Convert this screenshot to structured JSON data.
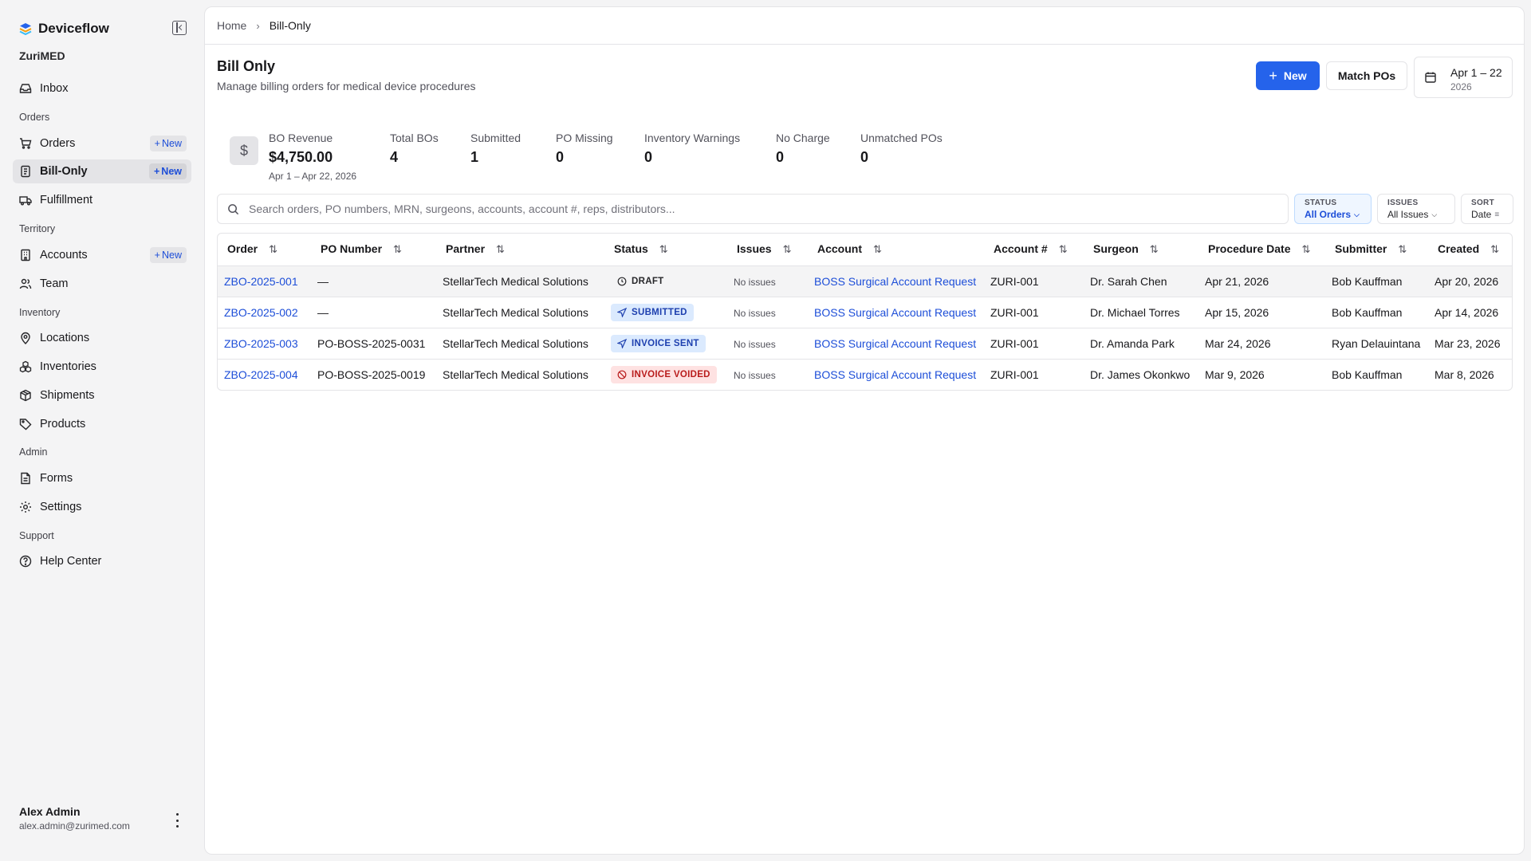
{
  "sidebar": {
    "brand": "Deviceflow",
    "org": "ZuriMED",
    "items": {
      "inbox": "Inbox",
      "orders_section": "Orders",
      "orders": "Orders",
      "bill_only": "Bill-Only",
      "fulfillment": "Fulfillment",
      "territory_section": "Territory",
      "accounts": "Accounts",
      "team": "Team",
      "inventory_section": "Inventory",
      "locations": "Locations",
      "inventories": "Inventories",
      "shipments": "Shipments",
      "products": "Products",
      "admin_section": "Admin",
      "forms": "Forms",
      "settings": "Settings",
      "support_section": "Support",
      "help_center": "Help Center"
    },
    "new_label": "New",
    "user": {
      "name": "Alex Admin",
      "email": "alex.admin@zurimed.com"
    }
  },
  "breadcrumb": {
    "home": "Home",
    "current": "Bill-Only"
  },
  "header": {
    "title": "Bill Only",
    "subtitle": "Manage billing orders for medical device procedures",
    "new_button": "New",
    "match_button": "Match POs",
    "date_range": "Apr 1 – 22",
    "date_year": "2026"
  },
  "stats": {
    "revenue_label": "BO Revenue",
    "revenue_value": "$4,750.00",
    "revenue_sub": "Apr 1 – Apr 22, 2026",
    "revenue_icon": "$",
    "total_label": "Total BOs",
    "total_value": "4",
    "submitted_label": "Submitted",
    "submitted_value": "1",
    "po_missing_label": "PO Missing",
    "po_missing_value": "0",
    "inv_warn_label": "Inventory Warnings",
    "inv_warn_value": "0",
    "no_charge_label": "No Charge",
    "no_charge_value": "0",
    "unmatched_label": "Unmatched POs",
    "unmatched_value": "0"
  },
  "search": {
    "placeholder": "Search orders, PO numbers, MRN, surgeons, accounts, account #, reps, distributors..."
  },
  "filters": {
    "status_label": "STATUS",
    "status_value": "All Orders",
    "issues_label": "ISSUES",
    "issues_value": "All Issues",
    "sort_label": "SORT",
    "sort_value": "Date"
  },
  "table": {
    "columns": [
      "Order",
      "PO Number",
      "Partner",
      "Status",
      "Issues",
      "Account",
      "Account #",
      "Surgeon",
      "Procedure Date",
      "Submitter",
      "Created"
    ],
    "rows": [
      {
        "order": "ZBO-2025-001",
        "po": "—",
        "partner": "StellarTech Medical Solutions",
        "status": "DRAFT",
        "issues": "No issues",
        "account": "BOSS Surgical Account Request",
        "account_no": "ZURI-001",
        "surgeon": "Dr. Sarah Chen",
        "procedure_date": "Apr 21, 2026",
        "submitter": "Bob Kauffman",
        "created": "Apr 20, 2026"
      },
      {
        "order": "ZBO-2025-002",
        "po": "—",
        "partner": "StellarTech Medical Solutions",
        "status": "SUBMITTED",
        "issues": "No issues",
        "account": "BOSS Surgical Account Request",
        "account_no": "ZURI-001",
        "surgeon": "Dr. Michael Torres",
        "procedure_date": "Apr 15, 2026",
        "submitter": "Bob Kauffman",
        "created": "Apr 14, 2026"
      },
      {
        "order": "ZBO-2025-003",
        "po": "PO-BOSS-2025-0031",
        "partner": "StellarTech Medical Solutions",
        "status": "INVOICE SENT",
        "issues": "No issues",
        "account": "BOSS Surgical Account Request",
        "account_no": "ZURI-001",
        "surgeon": "Dr. Amanda Park",
        "procedure_date": "Mar 24, 2026",
        "submitter": "Ryan Delauintana",
        "created": "Mar 23, 2026"
      },
      {
        "order": "ZBO-2025-004",
        "po": "PO-BOSS-2025-0019",
        "partner": "StellarTech Medical Solutions",
        "status": "INVOICE VOIDED",
        "issues": "No issues",
        "account": "BOSS Surgical Account Request",
        "account_no": "ZURI-001",
        "surgeon": "Dr. James Okonkwo",
        "procedure_date": "Mar 9, 2026",
        "submitter": "Bob Kauffman",
        "created": "Mar 8, 2026"
      }
    ]
  },
  "colors": {
    "accent": "#2563eb",
    "link": "#1d4ed8",
    "voided_bg": "#fee2e2",
    "blue_badge_bg": "#dbeafe"
  }
}
